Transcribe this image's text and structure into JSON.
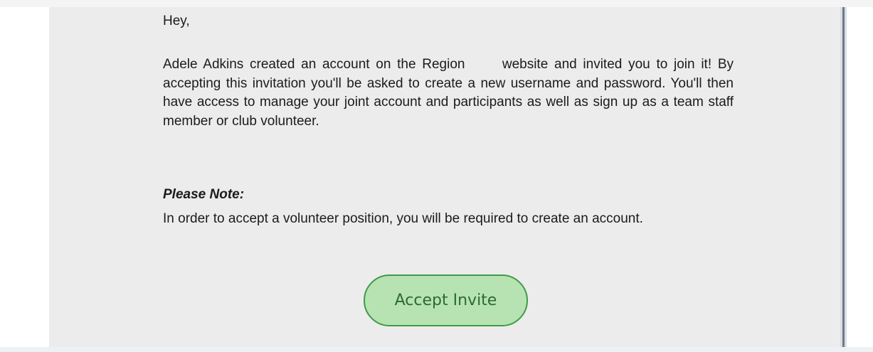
{
  "email": {
    "greeting": "Hey,",
    "body": "Adele Adkins created an account on the Region      website and invited you to join it! By accepting this invitation you'll be asked to create a new username and password. You'll then have access to manage your joint account and participants as well as sign up as a team staff member or club volunteer.",
    "note_heading": "Please Note:",
    "note_text": "In order to accept a volunteer position, you will be required to create an account.",
    "accept_button_label": "Accept Invite"
  },
  "colors": {
    "panel_background": "#ececec",
    "button_fill": "#b7e3b2",
    "button_border": "#3f9a4a",
    "button_text": "#2b6a33",
    "text": "#1b1b1b"
  }
}
